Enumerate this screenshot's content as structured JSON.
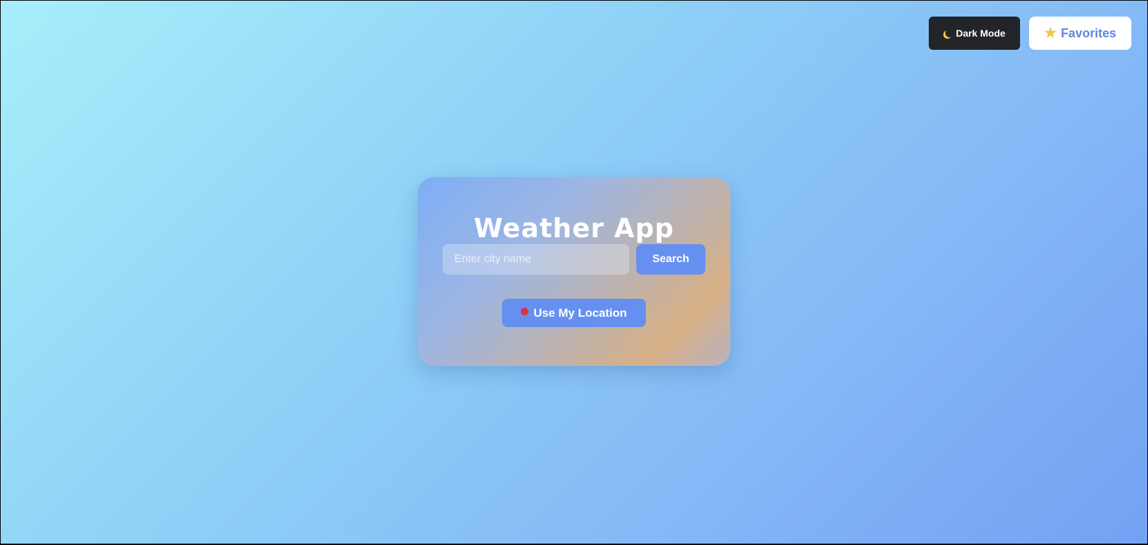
{
  "header": {
    "dark_mode_label": "Dark Mode",
    "dark_mode_icon": "moon-icon",
    "favorites_label": "Favorites",
    "favorites_icon": "star-icon"
  },
  "card": {
    "title": "Weather App",
    "search": {
      "placeholder": "Enter city name",
      "value": "",
      "button_label": "Search"
    },
    "location": {
      "label": "Use My Location",
      "icon": "pin-icon"
    }
  },
  "colors": {
    "background_start": "#a8eefa",
    "background_end": "#74a1f3",
    "accent_button": "#6590ef",
    "dark_button": "#222427",
    "favorites_text": "#5c88e0"
  }
}
